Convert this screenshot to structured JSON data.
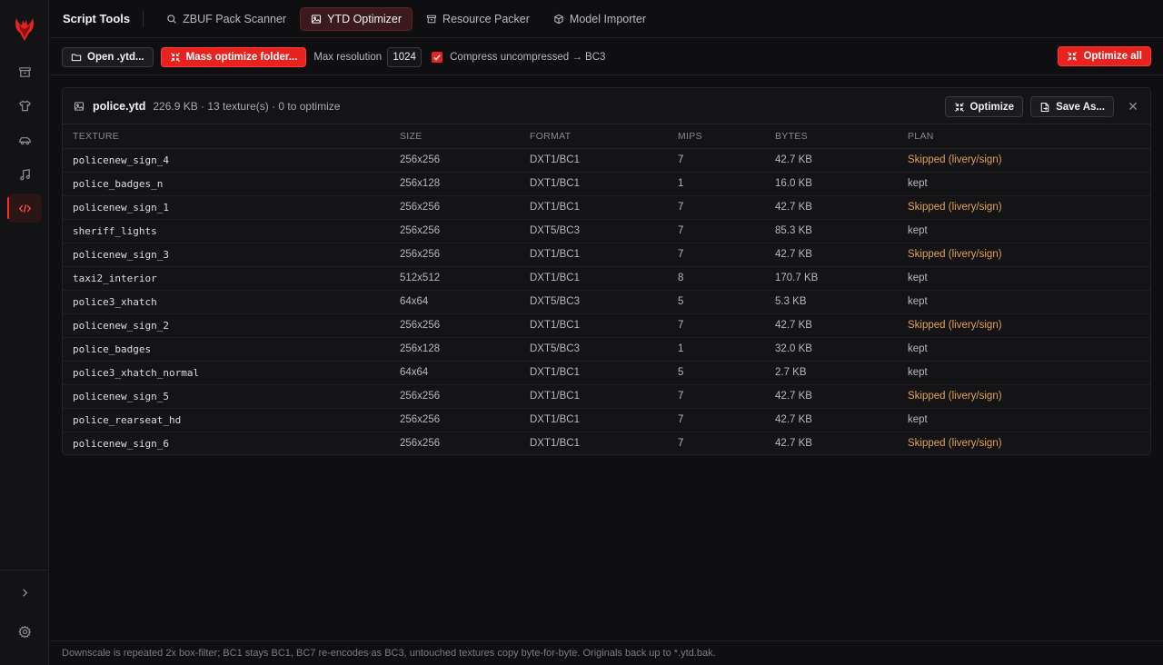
{
  "app": {
    "title": "Script Tools"
  },
  "tabs": [
    {
      "label": "ZBUF Pack Scanner",
      "icon": "search-icon",
      "active": false
    },
    {
      "label": "YTD Optimizer",
      "icon": "image-icon",
      "active": true
    },
    {
      "label": "Resource Packer",
      "icon": "archive-icon",
      "active": false
    },
    {
      "label": "Model Importer",
      "icon": "cube-icon",
      "active": false
    }
  ],
  "toolbar": {
    "open_label": "Open .ytd...",
    "mass_label": "Mass optimize folder...",
    "max_res_label": "Max resolution",
    "max_res_value": "1024",
    "compress_label": "Compress uncompressed → BC3",
    "compress_checked": true,
    "optimize_all_label": "Optimize all"
  },
  "file": {
    "name": "police.ytd",
    "meta": "226.9 KB · 13 texture(s) · 0 to optimize",
    "optimize_label": "Optimize",
    "save_as_label": "Save As..."
  },
  "table": {
    "columns": [
      "TEXTURE",
      "SIZE",
      "FORMAT",
      "MIPS",
      "BYTES",
      "PLAN"
    ],
    "rows": [
      [
        "policenew_sign_4",
        "256x256",
        "DXT1/BC1",
        "7",
        "42.7 KB",
        "Skipped (livery/sign)"
      ],
      [
        "police_badges_n",
        "256x128",
        "DXT1/BC1",
        "1",
        "16.0 KB",
        "kept"
      ],
      [
        "policenew_sign_1",
        "256x256",
        "DXT1/BC1",
        "7",
        "42.7 KB",
        "Skipped (livery/sign)"
      ],
      [
        "sheriff_lights",
        "256x256",
        "DXT5/BC3",
        "7",
        "85.3 KB",
        "kept"
      ],
      [
        "policenew_sign_3",
        "256x256",
        "DXT1/BC1",
        "7",
        "42.7 KB",
        "Skipped (livery/sign)"
      ],
      [
        "taxi2_interior",
        "512x512",
        "DXT1/BC1",
        "8",
        "170.7 KB",
        "kept"
      ],
      [
        "police3_xhatch",
        "64x64",
        "DXT5/BC3",
        "5",
        "5.3 KB",
        "kept"
      ],
      [
        "policenew_sign_2",
        "256x256",
        "DXT1/BC1",
        "7",
        "42.7 KB",
        "Skipped (livery/sign)"
      ],
      [
        "police_badges",
        "256x128",
        "DXT5/BC3",
        "1",
        "32.0 KB",
        "kept"
      ],
      [
        "police3_xhatch_normal",
        "64x64",
        "DXT1/BC1",
        "5",
        "2.7 KB",
        "kept"
      ],
      [
        "policenew_sign_5",
        "256x256",
        "DXT1/BC1",
        "7",
        "42.7 KB",
        "Skipped (livery/sign)"
      ],
      [
        "police_rearseat_hd",
        "256x256",
        "DXT1/BC1",
        "7",
        "42.7 KB",
        "kept"
      ],
      [
        "policenew_sign_6",
        "256x256",
        "DXT1/BC1",
        "7",
        "42.7 KB",
        "Skipped (livery/sign)"
      ]
    ]
  },
  "footer": {
    "text": "Downscale is repeated 2x box-filter; BC1 stays BC1, BC7 re-encodes as BC3, untouched textures copy byte-for-byte. Originals back up to *.ytd.bak."
  },
  "sidebar": {
    "items": [
      {
        "icon": "archive-icon",
        "active": false
      },
      {
        "icon": "shirt-icon",
        "active": false
      },
      {
        "icon": "car-icon",
        "active": false
      },
      {
        "icon": "music-icon",
        "active": false
      },
      {
        "icon": "code-icon",
        "active": true
      }
    ],
    "bottom": [
      "chevron-right-icon",
      "gear-icon"
    ]
  },
  "colors": {
    "accent": "#e8231f",
    "background": "#0f0f11",
    "panel": "#141416",
    "skip_text": "#e3a25a"
  }
}
